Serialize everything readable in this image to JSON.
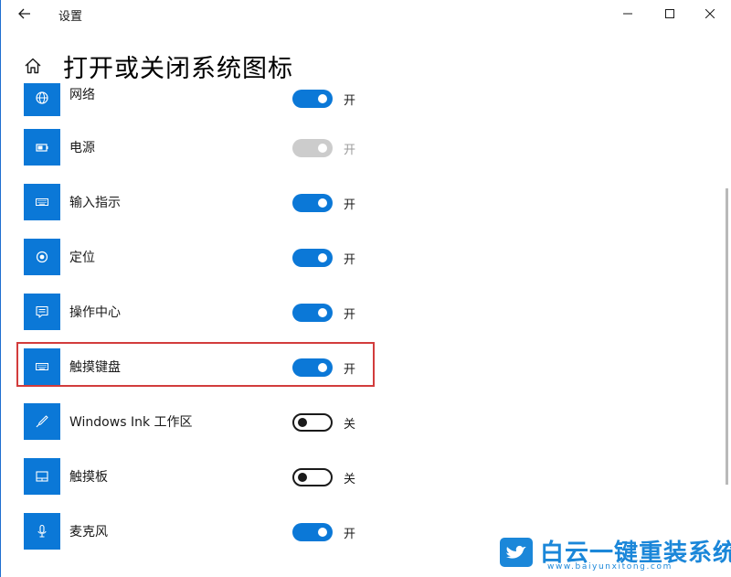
{
  "window": {
    "title": "设置"
  },
  "header": {
    "title": "打开或关闭系统图标"
  },
  "items": [
    {
      "label": "网络",
      "state": "开",
      "toggle": "on",
      "icon": "globe-icon"
    },
    {
      "label": "电源",
      "state": "开",
      "toggle": "disabled",
      "icon": "battery-icon"
    },
    {
      "label": "输入指示",
      "state": "开",
      "toggle": "on",
      "icon": "keyboard-icon"
    },
    {
      "label": "定位",
      "state": "开",
      "toggle": "on",
      "icon": "location-icon"
    },
    {
      "label": "操作中心",
      "state": "开",
      "toggle": "on",
      "icon": "action-center-icon"
    },
    {
      "label": "触摸键盘",
      "state": "开",
      "toggle": "on",
      "icon": "touch-keyboard-icon"
    },
    {
      "label": "Windows Ink 工作区",
      "state": "关",
      "toggle": "off",
      "icon": "pen-icon"
    },
    {
      "label": "触摸板",
      "state": "关",
      "toggle": "off",
      "icon": "touchpad-icon"
    },
    {
      "label": "麦克风",
      "state": "开",
      "toggle": "on",
      "icon": "microphone-icon"
    }
  ],
  "watermark": {
    "text": "白云一键重装系统",
    "url": "www.baiyunxitong.com"
  },
  "colors": {
    "accent": "#0b78d7",
    "highlight": "#d23c3c",
    "watermark": "#1b87d9"
  }
}
